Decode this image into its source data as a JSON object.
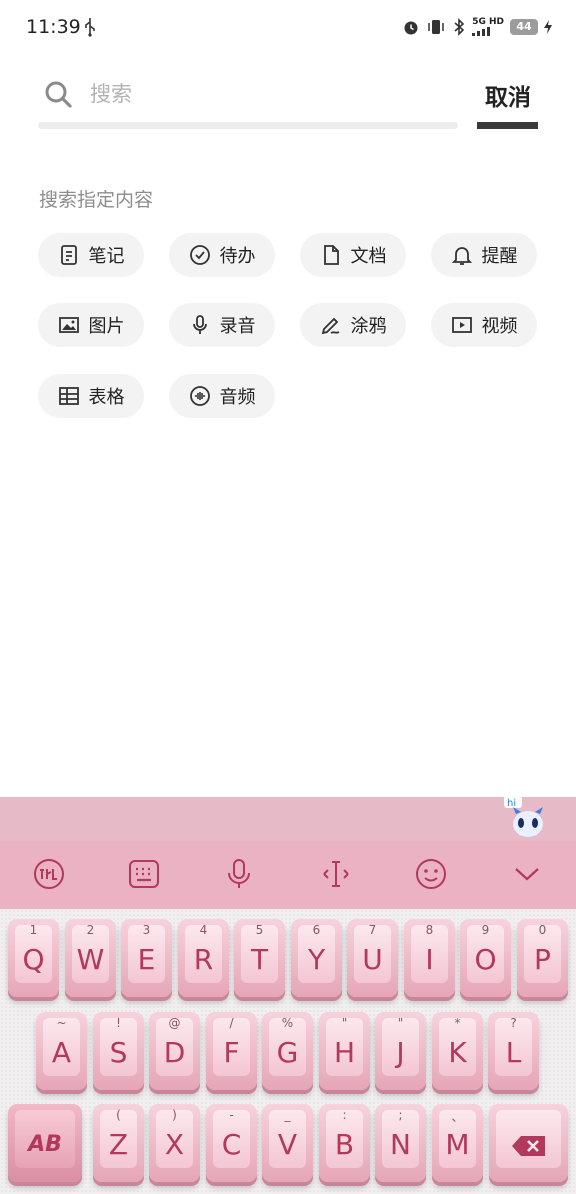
{
  "status_bar": {
    "time": "11:39",
    "network": "5G HD",
    "battery": "44"
  },
  "search": {
    "placeholder": "搜索",
    "value": "",
    "cancel_label": "取消"
  },
  "section": {
    "title": "搜索指定内容",
    "chips": [
      {
        "label": "笔记",
        "icon": "note-icon"
      },
      {
        "label": "待办",
        "icon": "todo-check-icon"
      },
      {
        "label": "文档",
        "icon": "document-icon"
      },
      {
        "label": "提醒",
        "icon": "bell-icon"
      },
      {
        "label": "图片",
        "icon": "image-icon"
      },
      {
        "label": "录音",
        "icon": "microphone-icon"
      },
      {
        "label": "涂鸦",
        "icon": "pen-doodle-icon"
      },
      {
        "label": "视频",
        "icon": "video-play-icon"
      },
      {
        "label": "表格",
        "icon": "table-icon"
      },
      {
        "label": "音频",
        "icon": "audio-wave-icon"
      }
    ]
  },
  "keyboard": {
    "candidate_bar_color": "#e7bac7",
    "toolbar_color": "#eab2c2",
    "mascot_text": "hi",
    "toolbar": [
      "ime-logo-icon",
      "keyboard-icon",
      "microphone-icon",
      "text-cursor-icon",
      "emoji-icon",
      "chevron-down-icon"
    ],
    "row1": [
      {
        "main": "Q",
        "sub": "1"
      },
      {
        "main": "W",
        "sub": "2"
      },
      {
        "main": "E",
        "sub": "3"
      },
      {
        "main": "R",
        "sub": "4"
      },
      {
        "main": "T",
        "sub": "5"
      },
      {
        "main": "Y",
        "sub": "6"
      },
      {
        "main": "U",
        "sub": "7"
      },
      {
        "main": "I",
        "sub": "8"
      },
      {
        "main": "O",
        "sub": "9"
      },
      {
        "main": "P",
        "sub": "0"
      }
    ],
    "row2": [
      {
        "main": "A",
        "sub": "~"
      },
      {
        "main": "S",
        "sub": "!"
      },
      {
        "main": "D",
        "sub": "@"
      },
      {
        "main": "F",
        "sub": "/"
      },
      {
        "main": "G",
        "sub": "%"
      },
      {
        "main": "H",
        "sub": "\""
      },
      {
        "main": "J",
        "sub": "\""
      },
      {
        "main": "K",
        "sub": "*"
      },
      {
        "main": "L",
        "sub": "?"
      }
    ],
    "row3": [
      {
        "main": "Z",
        "sub": "("
      },
      {
        "main": "X",
        "sub": ")"
      },
      {
        "main": "C",
        "sub": "-"
      },
      {
        "main": "V",
        "sub": "_"
      },
      {
        "main": "B",
        "sub": ":"
      },
      {
        "main": "N",
        "sub": ";"
      },
      {
        "main": "M",
        "sub": "、"
      }
    ],
    "shift_label": "AB"
  }
}
